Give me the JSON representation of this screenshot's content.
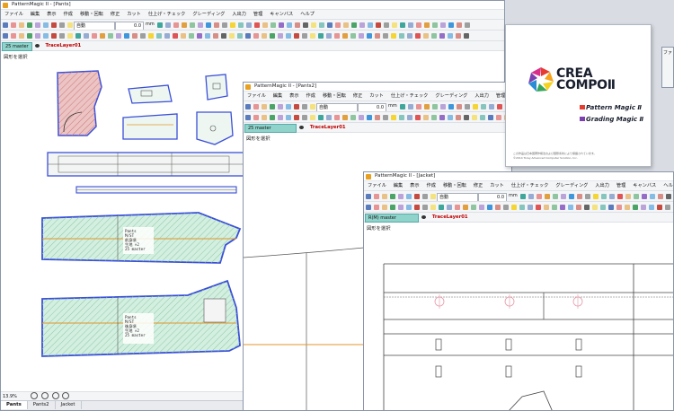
{
  "windows": {
    "pants": {
      "title": "PatternMagic II - [Pants]",
      "status": "図形を選択",
      "master": "25 master",
      "layer": "TraceLayer01",
      "zoom": "13.9%",
      "size_value": "0.0",
      "unit": "mm",
      "mode": "自動",
      "piece_label_1": "Pants\nM/ST\n前身頃\n生地 ×2\n25 master",
      "piece_label_2": "Pants\nM/ST\n後身頃\n生地 ×2\n25 master"
    },
    "pants2": {
      "title": "PatternMagic II - [Pants2]",
      "status": "図形を選択",
      "master": "25 master",
      "layer": "TraceLayer01",
      "size_value": "0.0",
      "unit": "mm",
      "mode": "自動"
    },
    "jacket": {
      "title": "PatternMagic II - [Jacket]",
      "status": "図形を選択",
      "master": "R(M) master",
      "layer": "TraceLayer01",
      "size_value": "0.0",
      "unit": "mm",
      "mode": "自動"
    }
  },
  "menu": [
    "ファイル",
    "編集",
    "表示",
    "作成",
    "移動・回転",
    "修正",
    "カット",
    "仕上げ・チェック",
    "グレーディング",
    "入出力",
    "管理",
    "キャンバス",
    "ヘルプ"
  ],
  "menu_jacket": [
    "ファイル",
    "編集",
    "表示",
    "作成",
    "移動・回転",
    "修正",
    "カット",
    "仕上げ・チェック",
    "グレーディング",
    "入出力",
    "管理",
    "キャンバス",
    "ヘルプ"
  ],
  "tabs": [
    {
      "label": "Pants",
      "active": true
    },
    {
      "label": "Pants2",
      "active": false
    },
    {
      "label": "Jacket",
      "active": false
    }
  ],
  "splash": {
    "brand_line1": "CREA",
    "brand_line2": "COMPO",
    "brand_numeral": "Ⅱ",
    "product1": "Pattern Magic Ⅱ",
    "product2": "Grading Magic Ⅱ",
    "fine1": "この作品は日本国著作権法および国際条約により保護されています。",
    "fine2": "©2014 Toray Advanced Computer Solution, Inc."
  },
  "side_window": {
    "label": "ファ"
  },
  "colors": {
    "accent": "#8fd3ca",
    "layer_text": "#c00000",
    "piece_green": "#cfeedd",
    "piece_pink": "#e8b4b4",
    "outline_blue": "#3a4fd8",
    "grain_orange": "#e0962a"
  }
}
